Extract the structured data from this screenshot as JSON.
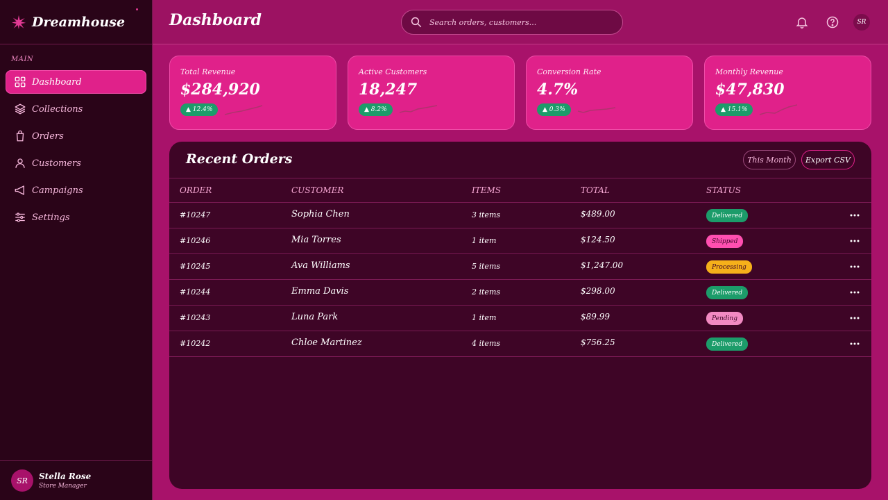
{
  "brand": {
    "name": "Dreamhouse"
  },
  "sidebar": {
    "section": "MAIN",
    "items": [
      {
        "label": "Dashboard",
        "icon": "grid-icon",
        "active": true
      },
      {
        "label": "Collections",
        "icon": "layers-icon"
      },
      {
        "label": "Orders",
        "icon": "bag-icon"
      },
      {
        "label": "Customers",
        "icon": "user-icon"
      },
      {
        "label": "Campaigns",
        "icon": "megaphone-icon"
      },
      {
        "label": "Settings",
        "icon": "sliders-icon"
      }
    ],
    "profile": {
      "initials": "SR",
      "name": "Stella Rose",
      "role": "Store Manager"
    }
  },
  "header": {
    "title": "Dashboard",
    "search_placeholder": "Search orders, customers...",
    "avatar_initials": "SR"
  },
  "stats": [
    {
      "label": "Total Revenue",
      "value": "$284,920",
      "change": "▲ 12.4%"
    },
    {
      "label": "Active Customers",
      "value": "18,247",
      "change": "▲ 8.2%"
    },
    {
      "label": "Conversion Rate",
      "value": "4.7%",
      "change": "▲ 0.3%"
    },
    {
      "label": "Monthly Revenue",
      "value": "$47,830",
      "change": "▲ 15.1%"
    }
  ],
  "orders": {
    "title": "Recent Orders",
    "filter_label": "This Month",
    "export_label": "Export CSV",
    "columns": [
      "ORDER",
      "CUSTOMER",
      "ITEMS",
      "TOTAL",
      "STATUS"
    ],
    "rows": [
      {
        "order": "#10247",
        "customer": "Sophia Chen",
        "items": "3 items",
        "total": "$489.00",
        "status": "Delivered"
      },
      {
        "order": "#10246",
        "customer": "Mia Torres",
        "items": "1 item",
        "total": "$124.50",
        "status": "Shipped"
      },
      {
        "order": "#10245",
        "customer": "Ava Williams",
        "items": "5 items",
        "total": "$1,247.00",
        "status": "Processing"
      },
      {
        "order": "#10244",
        "customer": "Emma Davis",
        "items": "2 items",
        "total": "$298.00",
        "status": "Delivered"
      },
      {
        "order": "#10243",
        "customer": "Luna Park",
        "items": "1 item",
        "total": "$89.99",
        "status": "Pending"
      },
      {
        "order": "#10242",
        "customer": "Chloe Martinez",
        "items": "4 items",
        "total": "$756.25",
        "status": "Delivered"
      }
    ]
  },
  "status_colors": {
    "Delivered": {
      "bg": "#1c9c6a",
      "fg": "#ffffff"
    },
    "Shipped": {
      "bg": "#ff4fb0",
      "fg": "#3e0526"
    },
    "Processing": {
      "bg": "#f5b01a",
      "fg": "#3e0526"
    },
    "Pending": {
      "bg": "#f28ac2",
      "fg": "#3e0526"
    }
  },
  "colors": {
    "accent": "#e0218a",
    "sidebar": "#2a0418",
    "panel": "#3e0526",
    "success": "#1c9c6a"
  }
}
